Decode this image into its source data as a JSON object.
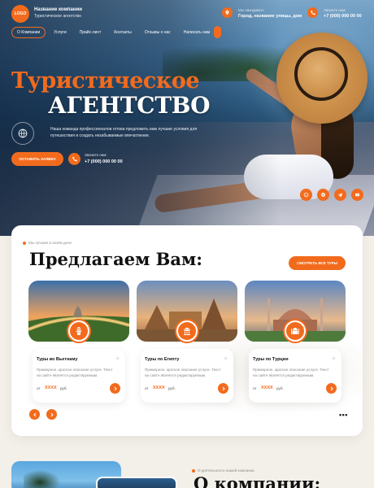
{
  "header": {
    "logo": "LOGO",
    "company_name": "Название компании",
    "company_sub": "Туристическое агентство",
    "address_label": "Мы находимся:",
    "address_value": "Город, название улицы, дом",
    "phone_label": "Звоните нам:",
    "phone_value": "+7 (000) 000 00 00"
  },
  "nav": {
    "items": [
      {
        "label": "О Компании"
      },
      {
        "label": "Услуги"
      },
      {
        "label": "Прайс-лист"
      },
      {
        "label": "Контакты"
      },
      {
        "label": "Отзывы о нас"
      },
      {
        "label": "Написать нам"
      }
    ]
  },
  "hero": {
    "title_line1": "Туристическое",
    "title_line2": "АГЕНТСТВО",
    "text": "Наша команда профессионалов готова предложить вам лучшие условия для путешествия и создать незабываемые впечатления.",
    "cta": "ОСТАВИТЬ ЗАЯВКУ",
    "phone_label": "Звоните нам:",
    "phone_value": "+7 (000) 000 00 00"
  },
  "offer": {
    "eyebrow": "Мы лучшие в своём деле",
    "title": "Предлагаем Вам:",
    "see_all": "СМОТРЕТЬ ВСЕ ТУРЫ",
    "cards": [
      {
        "title": "Туры во Вьетнаму",
        "desc": "Примерное, краткое описание услуги. Текст на сайте является редактируемым.",
        "from": "от",
        "price": "XXXX",
        "currency": "руб."
      },
      {
        "title": "Туры по Египту",
        "desc": "Примерное, краткое описание услуги. Текст на сайте является редактируемым.",
        "from": "от",
        "price": "XXXX",
        "currency": "руб."
      },
      {
        "title": "Туры по Турции",
        "desc": "Примерное, краткое описание услуги. Текст на сайте является редактируемым.",
        "from": "от",
        "price": "XXXX",
        "currency": "руб."
      }
    ],
    "quote_mark": "«",
    "dots": "•••"
  },
  "about": {
    "eyebrow": "О деятельности нашей компании",
    "title": "О компании:"
  },
  "colors": {
    "accent": "#f26b1d"
  }
}
